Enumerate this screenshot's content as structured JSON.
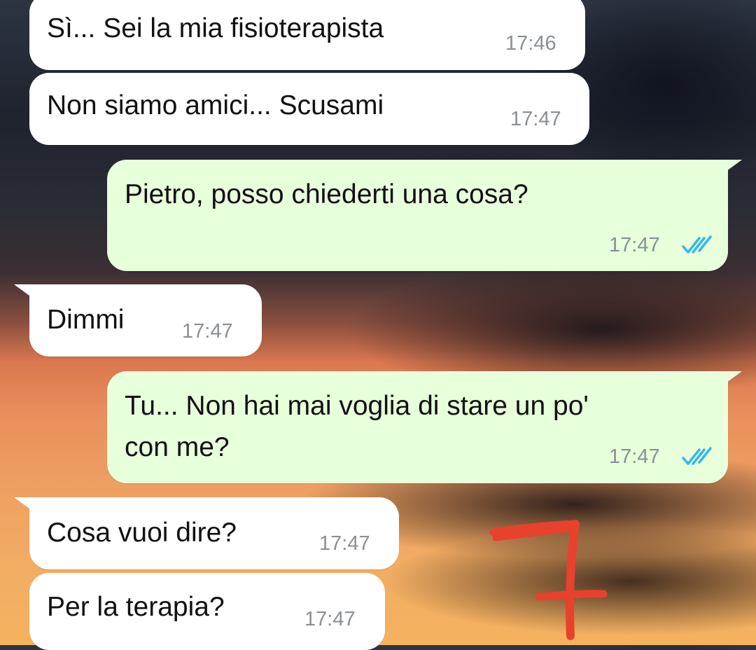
{
  "messages": [
    {
      "direction": "incoming",
      "text": "Sì... Sei la mia fisioterapista",
      "time": "17:46"
    },
    {
      "direction": "incoming",
      "text": "Non siamo amici... Scusami",
      "time": "17:47"
    },
    {
      "direction": "outgoing",
      "text": "Pietro, posso chiederti una cosa?",
      "time": "17:47",
      "status": "read"
    },
    {
      "direction": "incoming",
      "text": "Dimmi",
      "time": "17:47"
    },
    {
      "direction": "outgoing",
      "text_lines": [
        "Tu... Non hai mai voglia di stare un po'",
        "con me?"
      ],
      "time": "17:47",
      "status": "read"
    },
    {
      "direction": "incoming",
      "text": "Cosa vuoi dire?",
      "time": "17:47"
    },
    {
      "direction": "incoming",
      "text": "Per la terapia?",
      "time": "17:47"
    }
  ],
  "annotation": {
    "text": "7",
    "color": "#e8412e",
    "style": "handwritten"
  },
  "colors": {
    "incoming_bubble": "#ffffff",
    "outgoing_bubble": "#e7ffdb",
    "read_ticks": "#34b7f1",
    "timestamp": "#8a8f93"
  },
  "icons": {
    "read_status": "double-check-icon"
  }
}
